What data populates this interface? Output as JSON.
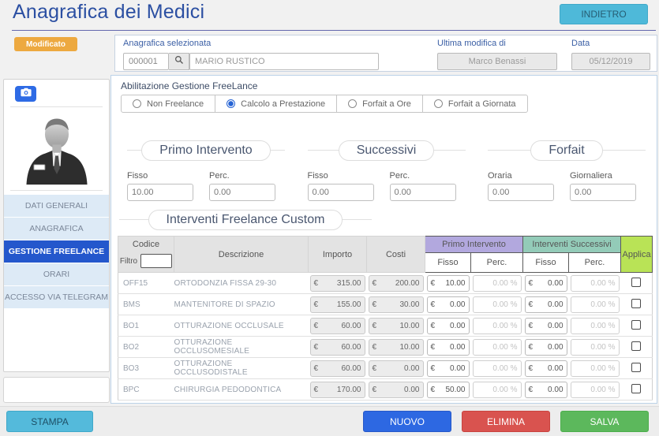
{
  "page": {
    "title": "Anagrafica dei Medici"
  },
  "header": {
    "back_button": "INDIETRO",
    "modified_badge": "Modificato"
  },
  "record_bar": {
    "selected_label": "Anagrafica selezionata",
    "code": "000001",
    "name": "MARIO RUSTICO",
    "last_modified_label": "Ultima modifica di",
    "last_modified_by": "Marco Benassi",
    "date_label": "Data",
    "date_value": "05/12/2019"
  },
  "sidebar": {
    "items": [
      {
        "label": "DATI GENERALI",
        "active": false
      },
      {
        "label": "ANAGRAFICA",
        "active": false
      },
      {
        "label": "GESTIONE FREELANCE",
        "active": true
      },
      {
        "label": "ORARI",
        "active": false
      },
      {
        "label": "ACCESSO VIA TELEGRAM",
        "active": false
      }
    ]
  },
  "freelance": {
    "enable_label": "Abilitazione Gestione FreeLance",
    "modes": [
      {
        "label": "Non Freelance",
        "selected": false
      },
      {
        "label": "Calcolo a Prestazione",
        "selected": true
      },
      {
        "label": "Forfait a Ore",
        "selected": false
      },
      {
        "label": "Forfait a Giornata",
        "selected": false
      }
    ],
    "groups": [
      {
        "title": "Primo Intervento",
        "fields": [
          {
            "label": "Fisso",
            "value": "10.00"
          },
          {
            "label": "Perc.",
            "value": "0.00"
          }
        ]
      },
      {
        "title": "Successivi",
        "fields": [
          {
            "label": "Fisso",
            "value": "0.00"
          },
          {
            "label": "Perc.",
            "value": "0.00"
          }
        ]
      },
      {
        "title": "Forfait",
        "fields": [
          {
            "label": "Oraria",
            "value": "0.00"
          },
          {
            "label": "Giornaliera",
            "value": "0.00"
          }
        ]
      }
    ]
  },
  "custom_section": {
    "title": "Interventi Freelance Custom",
    "table": {
      "currency": "€",
      "headers": {
        "codice": "Codice",
        "filtro": "Filtro",
        "descrizione": "Descrizione",
        "importo": "Importo",
        "costi": "Costi",
        "primo_intervento": "Primo Intervento",
        "interventi_successivi": "Interventi Successivi",
        "fisso": "Fisso",
        "perc": "Perc.",
        "applica": "Applica"
      },
      "filter_value": "",
      "rows": [
        {
          "code": "OFF15",
          "description": "ORTODONZIA FISSA 29-30",
          "importo": "315.00",
          "costi": "200.00",
          "pi_fisso": "10.00",
          "pi_perc": "0.00 %",
          "is_fisso": "0.00",
          "is_perc": "0.00 %",
          "applica": false
        },
        {
          "code": "BMS",
          "description": "MANTENITORE DI SPAZIO",
          "importo": "155.00",
          "costi": "30.00",
          "pi_fisso": "0.00",
          "pi_perc": "0.00 %",
          "is_fisso": "0.00",
          "is_perc": "0.00 %",
          "applica": false
        },
        {
          "code": "BO1",
          "description": "OTTURAZIONE OCCLUSALE",
          "importo": "60.00",
          "costi": "10.00",
          "pi_fisso": "0.00",
          "pi_perc": "0.00 %",
          "is_fisso": "0.00",
          "is_perc": "0.00 %",
          "applica": false
        },
        {
          "code": "BO2",
          "description": "OTTURAZIONE OCCLUSOMESIALE",
          "importo": "60.00",
          "costi": "10.00",
          "pi_fisso": "0.00",
          "pi_perc": "0.00 %",
          "is_fisso": "0.00",
          "is_perc": "0.00 %",
          "applica": false
        },
        {
          "code": "BO3",
          "description": "OTTURAZIONE OCCLUSODISTALE",
          "importo": "60.00",
          "costi": "0.00",
          "pi_fisso": "0.00",
          "pi_perc": "0.00 %",
          "is_fisso": "0.00",
          "is_perc": "0.00 %",
          "applica": false
        },
        {
          "code": "BPC",
          "description": "CHIRURGIA PEDODONTICA",
          "importo": "170.00",
          "costi": "0.00",
          "pi_fisso": "50.00",
          "pi_perc": "0.00 %",
          "is_fisso": "0.00",
          "is_perc": "0.00 %",
          "applica": false
        }
      ]
    }
  },
  "footer": {
    "print": "STAMPA",
    "new": "NUOVO",
    "delete": "ELIMINA",
    "save": "SALVA"
  },
  "colors": {
    "title_blue": "#2b4fa2",
    "accent_blue": "#2d68e2",
    "cyan": "#4eb9d9",
    "orange_badge": "#eda940",
    "purple_header": "#b2a8de",
    "teal_header": "#93cbb8",
    "lime_header": "#b9e356",
    "red": "#d9534f",
    "green": "#5cb85c",
    "sidebar_item_bg": "#ddeaf6",
    "sidebar_active_bg": "#2457cc"
  }
}
